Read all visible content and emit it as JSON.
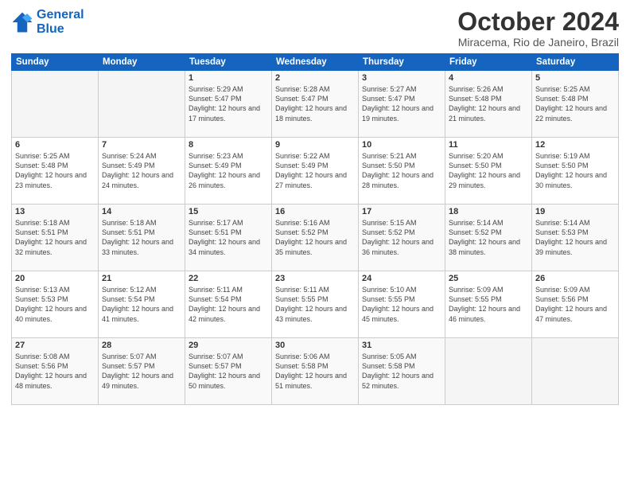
{
  "header": {
    "logo_line1": "General",
    "logo_line2": "Blue",
    "month_title": "October 2024",
    "location": "Miracema, Rio de Janeiro, Brazil"
  },
  "weekdays": [
    "Sunday",
    "Monday",
    "Tuesday",
    "Wednesday",
    "Thursday",
    "Friday",
    "Saturday"
  ],
  "weeks": [
    [
      {
        "day": "",
        "sunrise": "",
        "sunset": "",
        "daylight": ""
      },
      {
        "day": "",
        "sunrise": "",
        "sunset": "",
        "daylight": ""
      },
      {
        "day": "1",
        "sunrise": "Sunrise: 5:29 AM",
        "sunset": "Sunset: 5:47 PM",
        "daylight": "Daylight: 12 hours and 17 minutes."
      },
      {
        "day": "2",
        "sunrise": "Sunrise: 5:28 AM",
        "sunset": "Sunset: 5:47 PM",
        "daylight": "Daylight: 12 hours and 18 minutes."
      },
      {
        "day": "3",
        "sunrise": "Sunrise: 5:27 AM",
        "sunset": "Sunset: 5:47 PM",
        "daylight": "Daylight: 12 hours and 19 minutes."
      },
      {
        "day": "4",
        "sunrise": "Sunrise: 5:26 AM",
        "sunset": "Sunset: 5:48 PM",
        "daylight": "Daylight: 12 hours and 21 minutes."
      },
      {
        "day": "5",
        "sunrise": "Sunrise: 5:25 AM",
        "sunset": "Sunset: 5:48 PM",
        "daylight": "Daylight: 12 hours and 22 minutes."
      }
    ],
    [
      {
        "day": "6",
        "sunrise": "Sunrise: 5:25 AM",
        "sunset": "Sunset: 5:48 PM",
        "daylight": "Daylight: 12 hours and 23 minutes."
      },
      {
        "day": "7",
        "sunrise": "Sunrise: 5:24 AM",
        "sunset": "Sunset: 5:49 PM",
        "daylight": "Daylight: 12 hours and 24 minutes."
      },
      {
        "day": "8",
        "sunrise": "Sunrise: 5:23 AM",
        "sunset": "Sunset: 5:49 PM",
        "daylight": "Daylight: 12 hours and 26 minutes."
      },
      {
        "day": "9",
        "sunrise": "Sunrise: 5:22 AM",
        "sunset": "Sunset: 5:49 PM",
        "daylight": "Daylight: 12 hours and 27 minutes."
      },
      {
        "day": "10",
        "sunrise": "Sunrise: 5:21 AM",
        "sunset": "Sunset: 5:50 PM",
        "daylight": "Daylight: 12 hours and 28 minutes."
      },
      {
        "day": "11",
        "sunrise": "Sunrise: 5:20 AM",
        "sunset": "Sunset: 5:50 PM",
        "daylight": "Daylight: 12 hours and 29 minutes."
      },
      {
        "day": "12",
        "sunrise": "Sunrise: 5:19 AM",
        "sunset": "Sunset: 5:50 PM",
        "daylight": "Daylight: 12 hours and 30 minutes."
      }
    ],
    [
      {
        "day": "13",
        "sunrise": "Sunrise: 5:18 AM",
        "sunset": "Sunset: 5:51 PM",
        "daylight": "Daylight: 12 hours and 32 minutes."
      },
      {
        "day": "14",
        "sunrise": "Sunrise: 5:18 AM",
        "sunset": "Sunset: 5:51 PM",
        "daylight": "Daylight: 12 hours and 33 minutes."
      },
      {
        "day": "15",
        "sunrise": "Sunrise: 5:17 AM",
        "sunset": "Sunset: 5:51 PM",
        "daylight": "Daylight: 12 hours and 34 minutes."
      },
      {
        "day": "16",
        "sunrise": "Sunrise: 5:16 AM",
        "sunset": "Sunset: 5:52 PM",
        "daylight": "Daylight: 12 hours and 35 minutes."
      },
      {
        "day": "17",
        "sunrise": "Sunrise: 5:15 AM",
        "sunset": "Sunset: 5:52 PM",
        "daylight": "Daylight: 12 hours and 36 minutes."
      },
      {
        "day": "18",
        "sunrise": "Sunrise: 5:14 AM",
        "sunset": "Sunset: 5:52 PM",
        "daylight": "Daylight: 12 hours and 38 minutes."
      },
      {
        "day": "19",
        "sunrise": "Sunrise: 5:14 AM",
        "sunset": "Sunset: 5:53 PM",
        "daylight": "Daylight: 12 hours and 39 minutes."
      }
    ],
    [
      {
        "day": "20",
        "sunrise": "Sunrise: 5:13 AM",
        "sunset": "Sunset: 5:53 PM",
        "daylight": "Daylight: 12 hours and 40 minutes."
      },
      {
        "day": "21",
        "sunrise": "Sunrise: 5:12 AM",
        "sunset": "Sunset: 5:54 PM",
        "daylight": "Daylight: 12 hours and 41 minutes."
      },
      {
        "day": "22",
        "sunrise": "Sunrise: 5:11 AM",
        "sunset": "Sunset: 5:54 PM",
        "daylight": "Daylight: 12 hours and 42 minutes."
      },
      {
        "day": "23",
        "sunrise": "Sunrise: 5:11 AM",
        "sunset": "Sunset: 5:55 PM",
        "daylight": "Daylight: 12 hours and 43 minutes."
      },
      {
        "day": "24",
        "sunrise": "Sunrise: 5:10 AM",
        "sunset": "Sunset: 5:55 PM",
        "daylight": "Daylight: 12 hours and 45 minutes."
      },
      {
        "day": "25",
        "sunrise": "Sunrise: 5:09 AM",
        "sunset": "Sunset: 5:55 PM",
        "daylight": "Daylight: 12 hours and 46 minutes."
      },
      {
        "day": "26",
        "sunrise": "Sunrise: 5:09 AM",
        "sunset": "Sunset: 5:56 PM",
        "daylight": "Daylight: 12 hours and 47 minutes."
      }
    ],
    [
      {
        "day": "27",
        "sunrise": "Sunrise: 5:08 AM",
        "sunset": "Sunset: 5:56 PM",
        "daylight": "Daylight: 12 hours and 48 minutes."
      },
      {
        "day": "28",
        "sunrise": "Sunrise: 5:07 AM",
        "sunset": "Sunset: 5:57 PM",
        "daylight": "Daylight: 12 hours and 49 minutes."
      },
      {
        "day": "29",
        "sunrise": "Sunrise: 5:07 AM",
        "sunset": "Sunset: 5:57 PM",
        "daylight": "Daylight: 12 hours and 50 minutes."
      },
      {
        "day": "30",
        "sunrise": "Sunrise: 5:06 AM",
        "sunset": "Sunset: 5:58 PM",
        "daylight": "Daylight: 12 hours and 51 minutes."
      },
      {
        "day": "31",
        "sunrise": "Sunrise: 5:05 AM",
        "sunset": "Sunset: 5:58 PM",
        "daylight": "Daylight: 12 hours and 52 minutes."
      },
      {
        "day": "",
        "sunrise": "",
        "sunset": "",
        "daylight": ""
      },
      {
        "day": "",
        "sunrise": "",
        "sunset": "",
        "daylight": ""
      }
    ]
  ]
}
